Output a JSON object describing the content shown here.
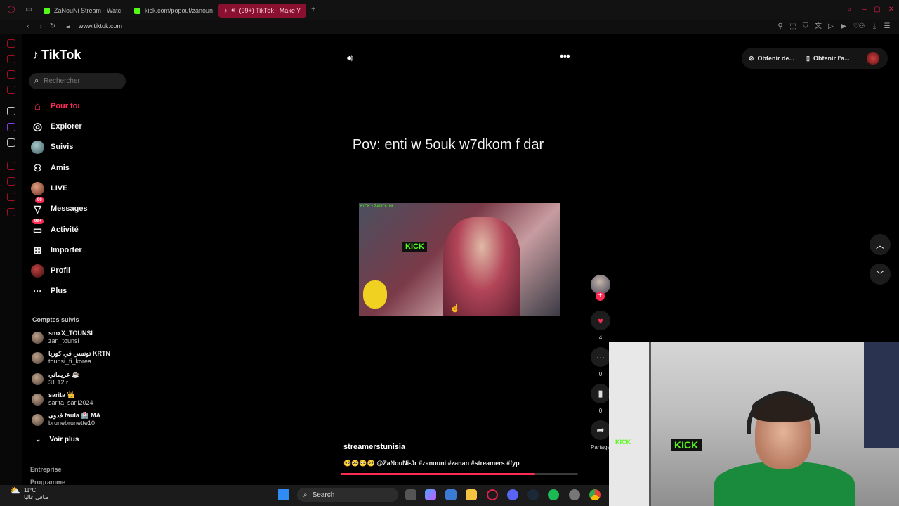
{
  "browser": {
    "tabs": [
      {
        "label": "ZaNouNi Stream - Watch",
        "color": "#53fc18"
      },
      {
        "label": "kick.com/popout/zanoun",
        "color": "#53fc18"
      },
      {
        "label": "(99+) TikTok - Make Y",
        "color": "#fe2c55",
        "active": true
      }
    ],
    "new_tab": "+",
    "url": "www.tiktok.com",
    "accent": "#b3102e"
  },
  "tiktok": {
    "logo_text": "TikTok",
    "search_placeholder": "Rechercher",
    "nav": [
      {
        "label": "Pour toi",
        "icon": "home-icon",
        "active": true
      },
      {
        "label": "Explorer",
        "icon": "compass-icon"
      },
      {
        "label": "Suivis",
        "icon": "avatar-icon"
      },
      {
        "label": "Amis",
        "icon": "friends-icon"
      },
      {
        "label": "LIVE",
        "icon": "avatar-icon"
      },
      {
        "label": "Messages",
        "icon": "send-icon",
        "badge": "90"
      },
      {
        "label": "Activité",
        "icon": "inbox-icon",
        "badge": "99+"
      },
      {
        "label": "Importer",
        "icon": "plus-square-icon"
      },
      {
        "label": "Profil",
        "icon": "avatar-icon"
      },
      {
        "label": "Plus",
        "icon": "ellipsis-icon"
      }
    ],
    "following_title": "Comptes suivis",
    "following": [
      {
        "name": "smxX_TOUNSI",
        "handle": "zan_tounsi"
      },
      {
        "name": "تونسي في كوريا KRTN",
        "handle": "tounsi_fi_korea"
      },
      {
        "name": "عريماني ☕",
        "handle": "31.12.r"
      },
      {
        "name": "sarita 👑",
        "handle": "sarita_sarii2024"
      },
      {
        "name": "فدوى faula 🏥 MA",
        "handle": "brunebrunette10"
      }
    ],
    "see_more": "Voir plus",
    "footer_links": [
      "Entreprise",
      "Programme"
    ],
    "top_buttons": [
      "Obtenir de...",
      "Obtenir l'a..."
    ],
    "video": {
      "caption": "Pov: enti w 5ouk w7dkom f dar",
      "overlay_brand": "KICK",
      "overlay_small": "KICK • ZANOUNI",
      "author": "streamerstunisia",
      "description": "🥺🥺🥺🥺 @ZaNouNi-Jr #zanouni #zanan #streamers #fyp",
      "progress": 0.82
    },
    "actions": {
      "likes": "4",
      "comments": "0",
      "saves": "0",
      "share_label": "Partage"
    }
  },
  "webcam": {
    "sign1": "KICK",
    "sign2": "KICK"
  },
  "taskbar": {
    "temperature": "11°C",
    "weather_desc": "صافي غالبا",
    "search_label": "Search"
  }
}
